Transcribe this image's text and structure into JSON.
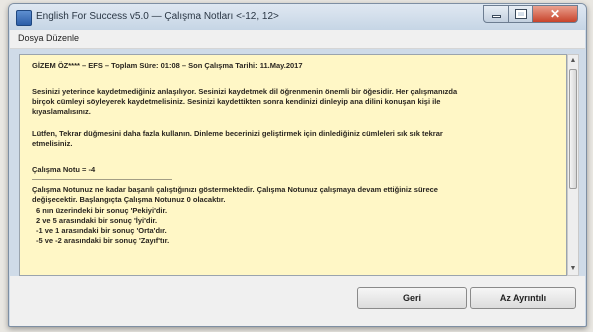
{
  "window": {
    "title": "English For Success v5.0 — Çalışma Notları <-12, 12>"
  },
  "menu": {
    "items": [
      "Dosya",
      "Düzenle"
    ]
  },
  "content": {
    "header": "GİZEM ÖZ**** – EFS – Toplam Süre: 01:08 – Son Çalışma Tarihi: 11.May.2017",
    "para1": [
      "Sesinizi yeterince kaydetmediğiniz anlaşılıyor.  Sesinizi kaydetmek dil öğrenmenin önemli bir öğesidir. Her çalışmanızda",
      "birçok cümleyi söyleyerek kaydetmelisiniz. Sesinizi kaydettikten sonra kendinizi dinleyip ana dilini konuşan kişi ile",
      "kıyaslamalısınız."
    ],
    "para2": [
      "Lütfen, Tekrar düğmesini daha fazla kullanın.  Dinleme becerinizi geliştirmek için dinlediğiniz cümleleri sık sık tekrar",
      "etmelisiniz."
    ],
    "score": "Çalışma Notu = -4",
    "para3": [
      "Çalışma Notunuz ne kadar başarılı çalıştığınızı göstermektedir.  Çalışma Notunuz çalışmaya devam ettiğiniz sürece",
      "değişecektir.  Başlangıçta Çalışma Notunuz  0  olacaktır."
    ],
    "levels": [
      "6 nın üzerindeki bir sonuç 'Pekiyi'dir.",
      "2 ve 5 arasındaki bir sonuç 'İyi'dir.",
      "-1 ve 1 arasındaki bir sonuç 'Orta'dır.",
      "-5 ve -2 arasındaki bir sonuç 'Zayıf'tır."
    ]
  },
  "buttons": {
    "back": "Geri",
    "details": "Az Ayrıntılı"
  },
  "colors": {
    "content_bg": "#fff7c6",
    "close_button": "#c8432b"
  }
}
